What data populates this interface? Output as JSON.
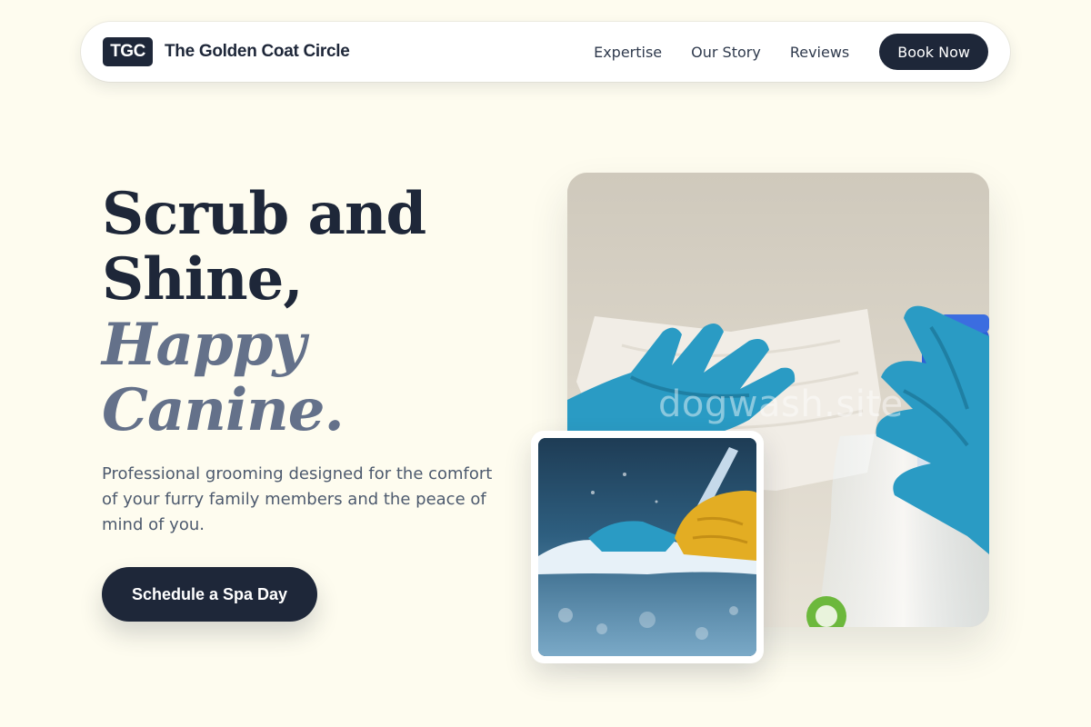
{
  "nav": {
    "logo_badge": "TGC",
    "brand_name": "The Golden Coat Circle",
    "links": [
      {
        "label": "Expertise"
      },
      {
        "label": "Our Story"
      },
      {
        "label": "Reviews"
      }
    ],
    "book_button": "Book Now"
  },
  "hero": {
    "title_line1": "Scrub and",
    "title_line2": "Shine,",
    "title_accent_line1": "Happy",
    "title_accent_line2": "Canine.",
    "subtitle": "Professional grooming designed for the comfort of your furry family members and the peace of mind of you.",
    "cta_button": "Schedule a Spa Day"
  },
  "images": {
    "main": {
      "icon": "gloved-hands-cleaning-photo",
      "watermark": "dogwash.site"
    },
    "inset": {
      "icon": "scrubbing-wet-surface-photo"
    }
  },
  "colors": {
    "background": "#fefcef",
    "primary": "#1e2739",
    "accent_text": "#64718a",
    "body_text": "#4d5a6e",
    "glove_blue": "#2a9bc4",
    "glove_yellow": "#e3ad23"
  }
}
